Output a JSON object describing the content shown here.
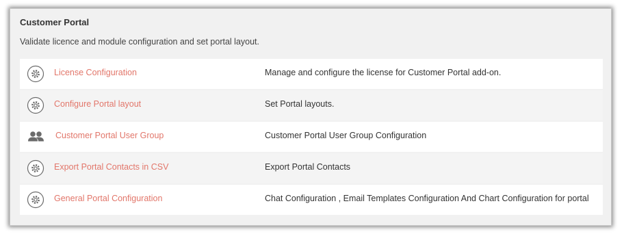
{
  "panel": {
    "title": "Customer Portal",
    "description": "Validate licence and module configuration and set portal layout."
  },
  "items": [
    {
      "icon": "gear-circle-icon",
      "label": "License Configuration",
      "description": "Manage and configure the license for Customer Portal add-on."
    },
    {
      "icon": "gear-circle-icon",
      "label": "Configure Portal layout",
      "description": "Set Portal layouts."
    },
    {
      "icon": "users-icon",
      "label": "Customer Portal User Group",
      "description": "Customer Portal User Group Configuration"
    },
    {
      "icon": "gear-circle-icon",
      "label": "Export Portal Contacts in CSV",
      "description": "Export Portal Contacts"
    },
    {
      "icon": "gear-circle-icon",
      "label": "General Portal Configuration",
      "description": "Chat Configuration , Email Templates Configuration And Chart Configuration for portal"
    }
  ],
  "colors": {
    "link": "#e2766a",
    "icon": "#6b6b6b"
  }
}
